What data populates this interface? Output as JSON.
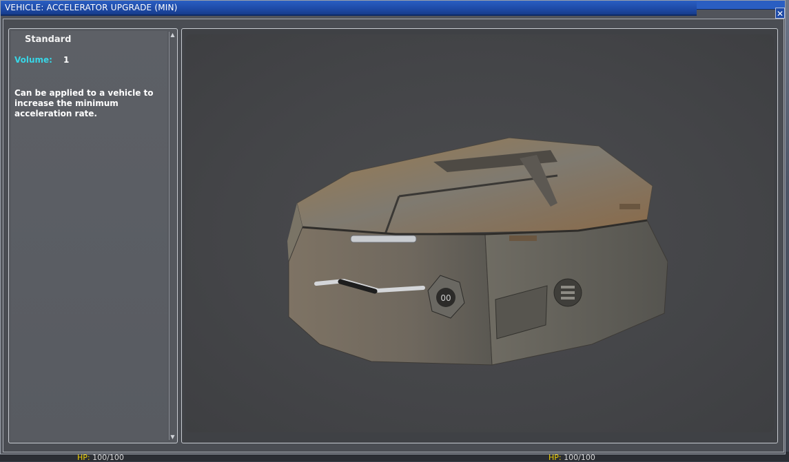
{
  "window": {
    "title": "VEHICLE: ACCELERATOR UPGRADE (MIN)",
    "close_label": "✕"
  },
  "item": {
    "name": "Standard",
    "volume_label": "Volume:",
    "volume_value": "1",
    "description": "Can be applied to a vehicle to increase the minimum acceleration rate."
  },
  "hud": {
    "hp_left_label": "HP:",
    "hp_left_value": "100/100",
    "hp_right_label": "HP:",
    "hp_right_value": "100/100"
  },
  "colors": {
    "titlebar": "#1e4aa6",
    "volume_label": "#38d6e6",
    "hp_label": "#f0d000"
  },
  "icons": {
    "close": "close-icon",
    "scroll_up": "arrow-up-icon",
    "scroll_down": "arrow-down-icon"
  }
}
